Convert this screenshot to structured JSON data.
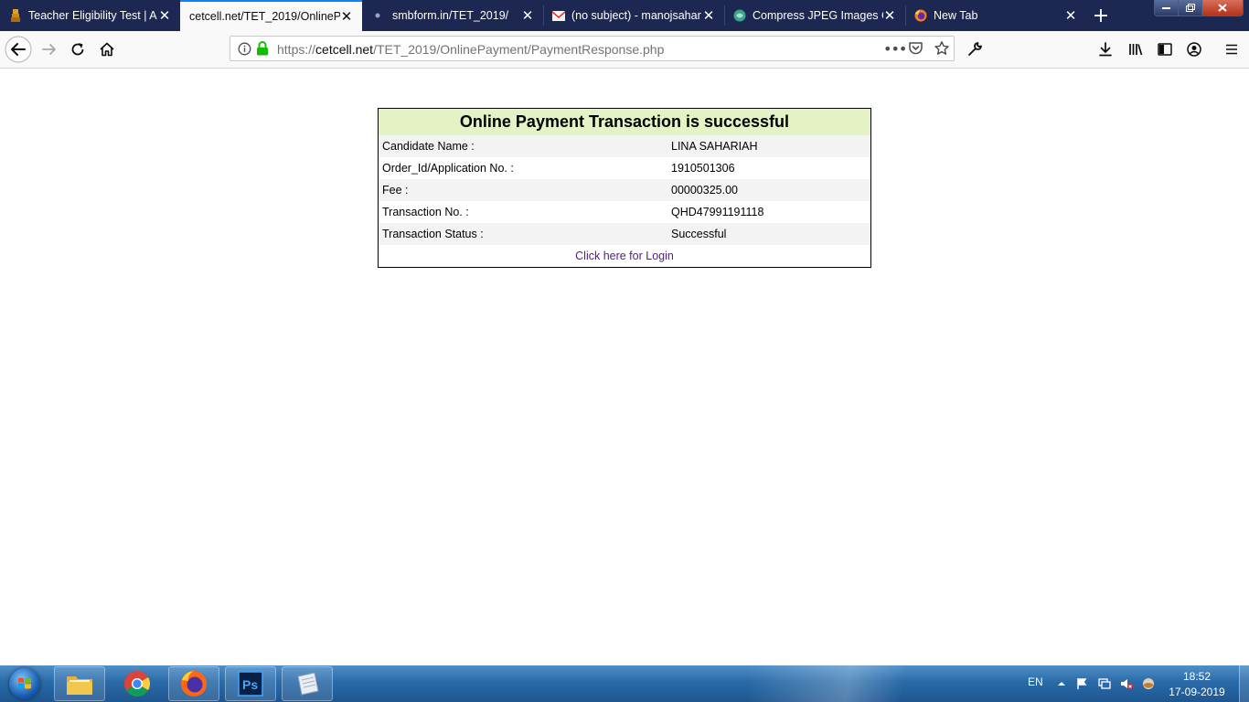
{
  "browser": {
    "tabs": [
      {
        "title": "Teacher Eligibility Test | A",
        "icon": "emblem-icon"
      },
      {
        "title": "cetcell.net/TET_2019/OnlineP",
        "icon": "none"
      },
      {
        "title": "smbform.in/TET_2019/",
        "icon": "dot-icon"
      },
      {
        "title": "(no subject) - manojsahar",
        "icon": "gmail-icon"
      },
      {
        "title": "Compress JPEG Images O",
        "icon": "compress-icon"
      },
      {
        "title": "New Tab",
        "icon": "firefox-icon"
      }
    ],
    "active_tab_index": 1,
    "url": {
      "scheme": "https://",
      "host": "cetcell.net",
      "path": "/TET_2019/OnlinePayment/PaymentResponse.php"
    }
  },
  "page": {
    "heading": "Online Payment Transaction is successful",
    "rows": [
      {
        "label": "Candidate Name :",
        "value": "LINA SAHARIAH"
      },
      {
        "label": "Order_Id/Application No. :",
        "value": "1910501306"
      },
      {
        "label": "Fee :",
        "value": "00000325.00"
      },
      {
        "label": "Transaction No. :",
        "value": "QHD47991191118"
      },
      {
        "label": "Transaction Status :",
        "value": "Successful"
      }
    ],
    "login_link": "Click here for Login"
  },
  "taskbar": {
    "apps": [
      "file-explorer-icon",
      "chrome-icon",
      "firefox-icon",
      "photoshop-icon",
      "notepad-icon"
    ],
    "language": "EN",
    "time": "18:52",
    "date": "17-09-2019"
  },
  "colors": {
    "tabbar": "#1c2852",
    "active_tab_accent": "#0a84ff",
    "heading_bg": "#e4f2c6",
    "link": "#551a8b"
  }
}
